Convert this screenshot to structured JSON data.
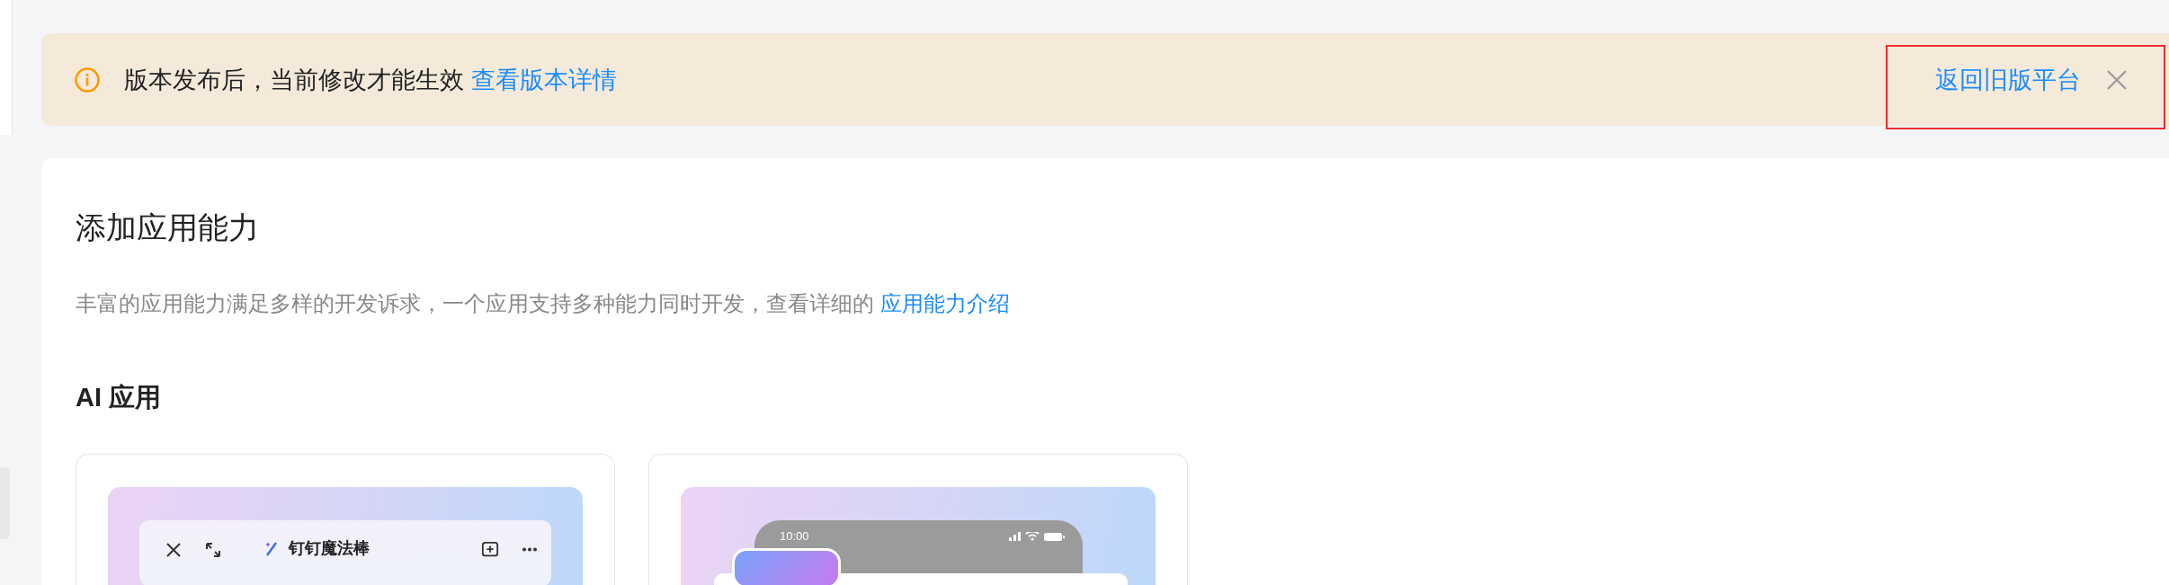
{
  "banner": {
    "message": "版本发布后，当前修改才能生效",
    "link": "查看版本详情",
    "back_link": "返回旧版平台"
  },
  "section": {
    "title": "添加应用能力",
    "description": "丰富的应用能力满足多样的开发诉求，一个应用支持多种能力同时开发，查看详细的",
    "description_link": "应用能力介绍"
  },
  "groups": [
    {
      "title": "AI 应用",
      "cards": [
        {
          "kind": "assistant-window",
          "window_title": "钉钉魔法棒"
        },
        {
          "kind": "phone",
          "time": "10:00"
        }
      ]
    }
  ]
}
